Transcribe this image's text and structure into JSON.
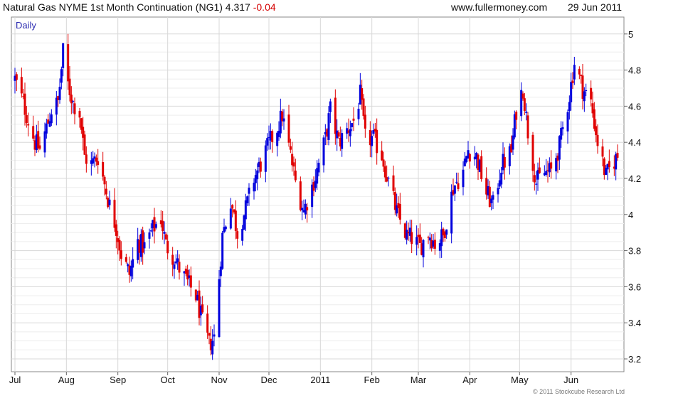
{
  "header": {
    "title": "Natural Gas NYME 1st Month Continuation (NG1)",
    "last": "4.317",
    "change": "-0.04",
    "site": "www.fullermoney.com",
    "date": "29 Jun 2011"
  },
  "footer": "© 2011 Stockcube Research Ltd",
  "chart_data": {
    "type": "candlestick",
    "period": "Daily",
    "colors": {
      "up": "#0000dd",
      "down": "#e00000",
      "grid": "#d8d8d8",
      "minor_grid": "#eeeeee"
    },
    "x_tick_labels": [
      "Jul",
      "Aug",
      "Sep",
      "Oct",
      "Nov",
      "Dec",
      "2011",
      "Feb",
      "Mar",
      "Apr",
      "May",
      "Jun"
    ],
    "y_tick_labels": [
      "3.2",
      "3.4",
      "3.6",
      "3.8",
      "4",
      "4.2",
      "4.4",
      "4.6",
      "4.8",
      "5"
    ],
    "ylim": [
      3.15,
      5.03
    ],
    "grid": true,
    "y_axis_side": "right",
    "series_close": [
      [
        "2010-07-01",
        4.75
      ],
      [
        "2010-07-06",
        4.62
      ],
      [
        "2010-07-09",
        4.52
      ],
      [
        "2010-07-13",
        4.4
      ],
      [
        "2010-07-16",
        4.36
      ],
      [
        "2010-07-20",
        4.48
      ],
      [
        "2010-07-23",
        4.58
      ],
      [
        "2010-07-27",
        4.62
      ],
      [
        "2010-07-30",
        4.9
      ],
      [
        "2010-08-02",
        4.72
      ],
      [
        "2010-08-05",
        4.62
      ],
      [
        "2010-08-09",
        4.56
      ],
      [
        "2010-08-12",
        4.32
      ],
      [
        "2010-08-16",
        4.28
      ],
      [
        "2010-08-20",
        4.32
      ],
      [
        "2010-08-24",
        4.17
      ],
      [
        "2010-08-27",
        4.05
      ],
      [
        "2010-08-31",
        3.93
      ],
      [
        "2010-09-03",
        3.78
      ],
      [
        "2010-09-08",
        3.67
      ],
      [
        "2010-09-13",
        3.85
      ],
      [
        "2010-09-17",
        3.82
      ],
      [
        "2010-09-22",
        3.92
      ],
      [
        "2010-09-27",
        3.98
      ],
      [
        "2010-09-30",
        3.83
      ],
      [
        "2010-10-05",
        3.76
      ],
      [
        "2010-10-08",
        3.7
      ],
      [
        "2010-10-13",
        3.62
      ],
      [
        "2010-10-18",
        3.55
      ],
      [
        "2010-10-22",
        3.4
      ],
      [
        "2010-10-26",
        3.28
      ],
      [
        "2010-10-29",
        3.32
      ],
      [
        "2010-11-03",
        3.88
      ],
      [
        "2010-11-08",
        4.08
      ],
      [
        "2010-11-12",
        3.9
      ],
      [
        "2010-11-17",
        4.03
      ],
      [
        "2010-11-22",
        4.2
      ],
      [
        "2010-11-26",
        4.28
      ],
      [
        "2010-12-01",
        4.39
      ],
      [
        "2010-12-06",
        4.48
      ],
      [
        "2010-12-09",
        4.55
      ],
      [
        "2010-12-14",
        4.33
      ],
      [
        "2010-12-17",
        4.18
      ],
      [
        "2010-12-22",
        4.02
      ],
      [
        "2010-12-29",
        4.21
      ],
      [
        "2011-01-04",
        4.42
      ],
      [
        "2011-01-07",
        4.58
      ],
      [
        "2011-01-12",
        4.4
      ],
      [
        "2011-01-18",
        4.48
      ],
      [
        "2011-01-21",
        4.52
      ],
      [
        "2011-01-25",
        4.66
      ],
      [
        "2011-01-28",
        4.42
      ],
      [
        "2011-02-02",
        4.42
      ],
      [
        "2011-02-07",
        4.33
      ],
      [
        "2011-02-11",
        4.18
      ],
      [
        "2011-02-16",
        4.01
      ],
      [
        "2011-02-22",
        3.88
      ],
      [
        "2011-02-25",
        3.87
      ],
      [
        "2011-03-02",
        3.82
      ],
      [
        "2011-03-07",
        3.9
      ],
      [
        "2011-03-11",
        3.84
      ],
      [
        "2011-03-16",
        3.88
      ],
      [
        "2011-03-22",
        4.15
      ],
      [
        "2011-03-28",
        4.24
      ],
      [
        "2011-03-31",
        4.36
      ],
      [
        "2011-04-05",
        4.32
      ],
      [
        "2011-04-11",
        4.12
      ],
      [
        "2011-04-15",
        4.05
      ],
      [
        "2011-04-20",
        4.27
      ],
      [
        "2011-04-26",
        4.35
      ],
      [
        "2011-04-29",
        4.58
      ],
      [
        "2011-05-03",
        4.7
      ],
      [
        "2011-05-06",
        4.46
      ],
      [
        "2011-05-11",
        4.18
      ],
      [
        "2011-05-16",
        4.23
      ],
      [
        "2011-05-20",
        4.24
      ],
      [
        "2011-05-25",
        4.38
      ],
      [
        "2011-05-31",
        4.66
      ],
      [
        "2011-06-03",
        4.84
      ],
      [
        "2011-06-08",
        4.7
      ],
      [
        "2011-06-13",
        4.62
      ],
      [
        "2011-06-17",
        4.4
      ],
      [
        "2011-06-22",
        4.21
      ],
      [
        "2011-06-27",
        4.3
      ],
      [
        "2011-06-29",
        4.32
      ]
    ]
  }
}
